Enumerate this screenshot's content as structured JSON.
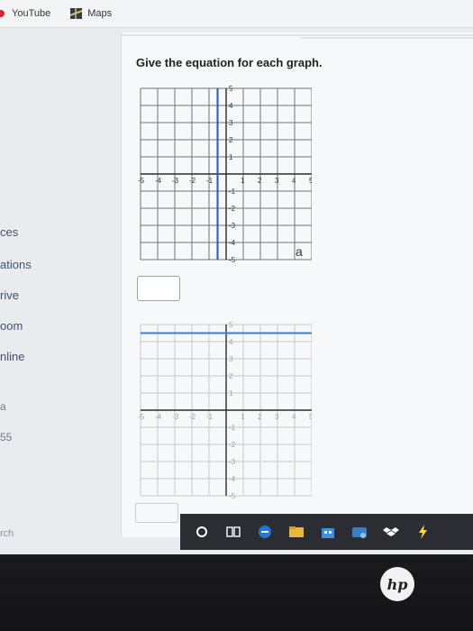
{
  "bookmarks": [
    {
      "label": "YouTube",
      "icon": "youtube-icon"
    },
    {
      "label": "Maps",
      "icon": "maps-icon"
    }
  ],
  "question": {
    "title": "Give the equation for each graph."
  },
  "sidebar": {
    "items": [
      "ces",
      "ations",
      "rive",
      "oom",
      "nline"
    ],
    "extras": [
      "a",
      "55"
    ]
  },
  "graph1": {
    "x_ticks": [
      "-5",
      "-4",
      "-3",
      "-2",
      "-1",
      "1",
      "2",
      "3",
      "4",
      "5"
    ],
    "y_ticks": [
      "5",
      "4",
      "3",
      "2",
      "1",
      "-1",
      "-2",
      "-3",
      "-4",
      "-5"
    ],
    "part_label": "a",
    "line": {
      "orientation": "vertical",
      "x": -0.5
    },
    "line_color": "#2a55c0"
  },
  "graph2": {
    "x_ticks": [
      "-5",
      "-4",
      "-3",
      "-2",
      "-1",
      "1",
      "2",
      "3",
      "4",
      "5"
    ],
    "y_ticks": [
      "5",
      "4",
      "3",
      "2",
      "1",
      "-1",
      "-2",
      "-3",
      "-4",
      "-5"
    ],
    "line": {
      "orientation": "horizontal",
      "y": 4.5
    },
    "line_color": "#3a7fd0"
  },
  "answer_box": {
    "value": ""
  },
  "taskbar": {
    "icons": [
      "circle-icon",
      "task-view-icon",
      "edge-icon",
      "file-explorer-icon",
      "store-icon",
      "mail-icon",
      "dropbox-icon",
      "app-icon"
    ],
    "search_hint": "rch"
  },
  "device": {
    "logo": "hp"
  }
}
